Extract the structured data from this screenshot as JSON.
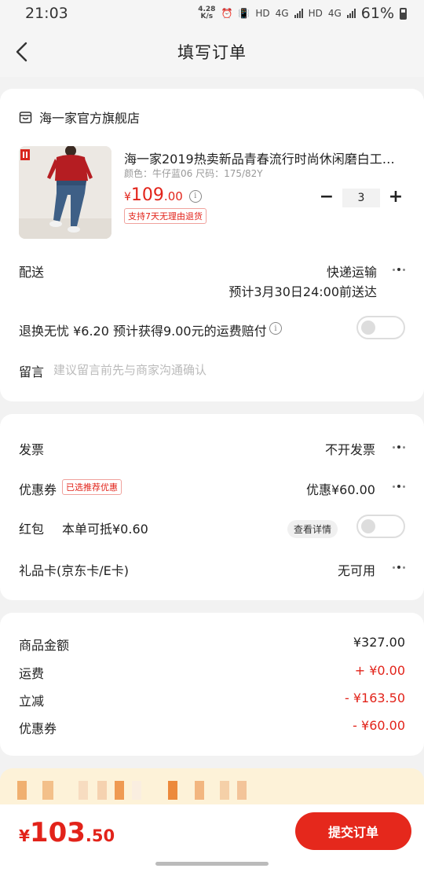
{
  "status_bar": {
    "time": "21:03",
    "net_speed_value": "4.28",
    "net_speed_unit": "K/s",
    "hd1": "HD",
    "net1": "4G",
    "hd2": "HD",
    "net2": "4G",
    "battery": "61%"
  },
  "nav": {
    "title": "填写订单"
  },
  "shop": {
    "name": "海一家官方旗舰店"
  },
  "product": {
    "title": "海一家2019热卖新品青春流行时尚休闲磨白工艺…",
    "spec": "颜色：牛仔蓝06   尺码：175/82Y",
    "price_currency": "¥",
    "price_int": "109",
    "price_dec": ".00",
    "return_policy": "支持7天无理由退货",
    "quantity": "3",
    "minus": "−",
    "plus": "+"
  },
  "delivery": {
    "label": "配送",
    "method": "快递运输",
    "eta": "预计3月30日24:00前送达"
  },
  "insurance": {
    "text": "退换无忧 ¥6.20  预计获得9.00元的运费赔付"
  },
  "message": {
    "label": "留言",
    "placeholder": "建议留言前先与商家沟通确认"
  },
  "invoice": {
    "label": "发票",
    "value": "不开发票"
  },
  "coupon": {
    "label": "优惠券",
    "tag": "已选推荐优惠",
    "value": "优惠¥60.00"
  },
  "red_packet": {
    "label": "红包",
    "desc": "本单可抵¥0.60",
    "detail_button": "查看详情"
  },
  "gift_card": {
    "label": "礼品卡(京东卡/E卡)",
    "value": "无可用"
  },
  "summary": [
    {
      "label": "商品金额",
      "value": "¥327.00",
      "color": "#222222"
    },
    {
      "label": "运费",
      "value": "+ ¥0.00",
      "color": "#e2231a"
    },
    {
      "label": "立减",
      "value": "- ¥163.50",
      "color": "#e2231a"
    },
    {
      "label": "优惠券",
      "value": "- ¥60.00",
      "color": "#e2231a"
    }
  ],
  "footer": {
    "total_currency": "¥",
    "total_int": "103",
    "total_dec": ".50",
    "submit_label": "提交订单"
  },
  "colors": {
    "accent": "#e2231a",
    "promo_bg": "#fdf2d8"
  }
}
